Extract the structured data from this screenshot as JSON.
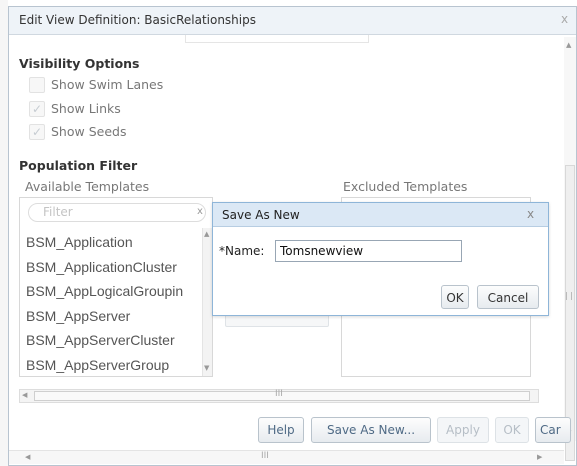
{
  "dialog": {
    "title": "Edit View Definition: BasicRelationships",
    "close_glyph": "x"
  },
  "visibility": {
    "heading": "Visibility Options",
    "options": [
      {
        "label": "Show Swim Lanes",
        "checked": false
      },
      {
        "label": "Show Links",
        "checked": true
      },
      {
        "label": "Show Seeds",
        "checked": true
      }
    ]
  },
  "population": {
    "heading": "Population Filter",
    "available_label": "Available Templates",
    "excluded_label": "Excluded Templates",
    "filter_placeholder": "Filter",
    "filter_clear": "x",
    "templates": [
      "BSM_Application",
      "BSM_ApplicationCluster",
      "BSM_AppLogicalGroupin",
      "BSM_AppServer",
      "BSM_AppServerCluster",
      "BSM_AppServerGroup"
    ]
  },
  "buttons": {
    "help": "Help",
    "save_as_new": "Save As New...",
    "apply": "Apply",
    "ok": "OK",
    "cancel": "Car"
  },
  "popup": {
    "title": "Save As New",
    "close_glyph": "x",
    "name_label": "*Name:",
    "name_value": "Tomsnewview",
    "ok": "OK",
    "cancel": "Cancel"
  },
  "scroll_grip": "III",
  "icons": {
    "arrow_up": "▲",
    "arrow_down": "▼",
    "arrow_left": "◀",
    "arrow_right": "▶",
    "check": "✓"
  }
}
